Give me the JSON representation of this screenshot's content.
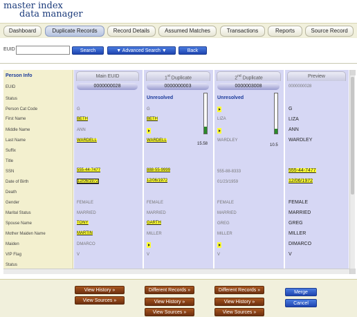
{
  "app": {
    "logo_line1": "master index",
    "logo_line2": "data manager"
  },
  "tabs": [
    {
      "label": "Dashboard"
    },
    {
      "label": "Duplicate Records"
    },
    {
      "label": "Record Details"
    },
    {
      "label": "Assumed Matches"
    },
    {
      "label": "Transactions"
    },
    {
      "label": "Reports"
    },
    {
      "label": "Source Record"
    }
  ],
  "search": {
    "label": "EUID",
    "value": "",
    "search_button": "Search",
    "advanced_button": "▼ Advanced Search ▼",
    "back_button": "Back"
  },
  "panel": {
    "title": "Person Info",
    "row_labels": [
      "EUID",
      "Status",
      "Person Cat Code",
      "First Name",
      "Middle Name",
      "Last Name",
      "Suffix",
      "Title",
      "SSN",
      "Date of Birth",
      "Death",
      "Gender",
      "Marital Status",
      "Spouse Name",
      "Mother Maiden Name",
      "Maiden",
      "VIP Flag",
      "Status"
    ]
  },
  "columns": {
    "main": {
      "header": "Main EUID",
      "euid": "0000000028",
      "cells": [
        "",
        "G",
        "BETH",
        "ANN",
        "WARDELL",
        "",
        "",
        "555-44-7477",
        "12/06/1972",
        "",
        "FEMALE",
        "MARRIED",
        "TONY",
        "MARTIN",
        "DMARCO",
        "V"
      ]
    },
    "dup1": {
      "header_prefix": "1",
      "header_sup": "st",
      "header_suffix": " Duplicate",
      "euid": "0000000003",
      "status": "Unresolved",
      "score": "15.58",
      "score_fraction": 0.18,
      "cells": [
        "G",
        "BETH",
        "",
        "WARDELL",
        "",
        "",
        "888-55-9999",
        "12/06/1972",
        "",
        "FEMALE",
        "MARRIED",
        "GARTH",
        "MILLER",
        "",
        "V"
      ]
    },
    "dup2": {
      "header_prefix": "2",
      "header_sup": "nd",
      "header_suffix": " Duplicate",
      "euid": "0000003008",
      "status": "Unresolved",
      "score": "10.5",
      "score_fraction": 0.12,
      "cells": [
        "",
        "LIZA",
        "",
        "WARDLEY",
        "",
        "",
        "555-88-8333",
        "01/23/1959",
        "",
        "FEMALE",
        "MARRIED",
        "GREG",
        "MILLER",
        "",
        "V"
      ]
    },
    "preview": {
      "header": "Preview",
      "euid": "0000000028",
      "cells": [
        "G",
        "LIZA",
        "ANN",
        "WARDLEY",
        "",
        "",
        "555-44-7477",
        "12/06/1972",
        "",
        "FEMALE",
        "MARRIED",
        "GREG",
        "MILLER",
        "DIMARCO",
        "V"
      ]
    }
  },
  "buttons": {
    "view_history": "View History",
    "view_sources": "View Sources",
    "different_records": "Different Records",
    "merge": "Merge",
    "cancel": "Cancel"
  },
  "colors": {
    "accent_blue": "#1f45b0",
    "highlight": "#ffff33",
    "brown": "#6d3010"
  }
}
